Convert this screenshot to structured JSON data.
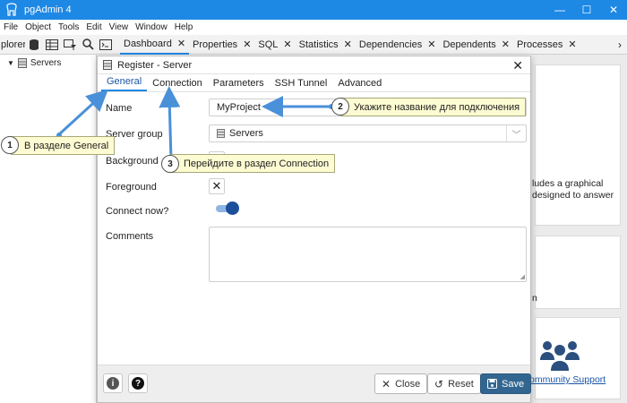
{
  "window": {
    "title": "pgAdmin 4",
    "minimize": "—",
    "maximize": "☐",
    "close": "✕"
  },
  "menu": [
    "File",
    "Object",
    "Tools",
    "Edit",
    "View",
    "Window",
    "Help"
  ],
  "toolbar": {
    "explorer_label": "plorer"
  },
  "tabs": [
    {
      "label": "Dashboard",
      "active": true
    },
    {
      "label": "Properties"
    },
    {
      "label": "SQL"
    },
    {
      "label": "Statistics"
    },
    {
      "label": "Dependencies"
    },
    {
      "label": "Dependents"
    },
    {
      "label": "Processes"
    }
  ],
  "tree": {
    "root": "Servers"
  },
  "background": {
    "desc_line1": "ludes a graphical",
    "desc_line2": "designed to answer",
    "fragment": "n",
    "support_link": "ommunity Support"
  },
  "dialog": {
    "title": "Register - Server",
    "tabs": [
      "General",
      "Connection",
      "Parameters",
      "SSH Tunnel",
      "Advanced"
    ],
    "active_tab": "General",
    "fields": {
      "name_label": "Name",
      "name_value": "MyProject",
      "server_group_label": "Server group",
      "server_group_value": "Servers",
      "background_label": "Background",
      "foreground_label": "Foreground",
      "connect_now_label": "Connect now?",
      "connect_now": true,
      "comments_label": "Comments"
    },
    "footer": {
      "info": "i",
      "help": "?",
      "close": "Close",
      "reset": "Reset",
      "save": "Save"
    }
  },
  "callouts": [
    {
      "num": "1",
      "text": "В разделе General"
    },
    {
      "num": "2",
      "text": "Укажите название для подключения"
    },
    {
      "num": "3",
      "text": "Перейдите в раздел Connection"
    }
  ],
  "colors": {
    "accent": "#1e88e5",
    "save_button": "#326690",
    "callout_bg": "#fdfbd2",
    "arrow": "#4a90d9"
  }
}
